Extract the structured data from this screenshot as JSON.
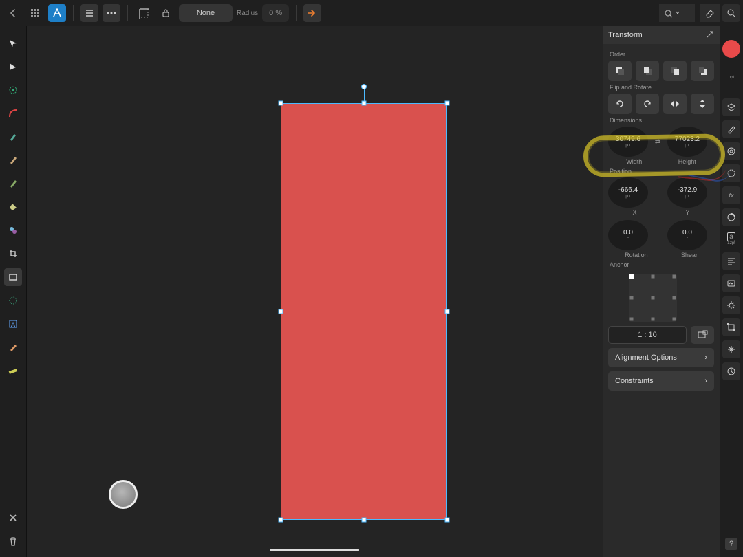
{
  "topbar": {
    "style_label": "None",
    "radius_label": "Radius",
    "radius_value": "0 %"
  },
  "left_slider": {
    "value_label": "0.0pt"
  },
  "panel": {
    "title": "Transform",
    "order_label": "Order",
    "flip_rotate_label": "Flip and Rotate",
    "dimensions_label": "Dimensions",
    "width_value": "30749.6",
    "width_unit": "px",
    "width_label": "Width",
    "height_value": "77023.2",
    "height_unit": "px",
    "height_label": "Height",
    "position_label": "Position",
    "x_value": "-666.4",
    "x_unit": "px",
    "x_label": "X",
    "y_value": "-372.9",
    "y_unit": "px",
    "y_label": "Y",
    "rotation_value": "0.0",
    "rotation_unit": "°",
    "rotation_label": "Rotation",
    "shear_value": "0.0",
    "shear_unit": "°",
    "shear_label": "Shear",
    "anchor_label": "Anchor",
    "ratio_value": "1 : 10",
    "alignment_label": "Alignment Options",
    "constraints_label": "Constraints"
  },
  "right_dock": {
    "font_size_hint": "12pt"
  },
  "shape": {
    "fill": "#d9514e"
  }
}
